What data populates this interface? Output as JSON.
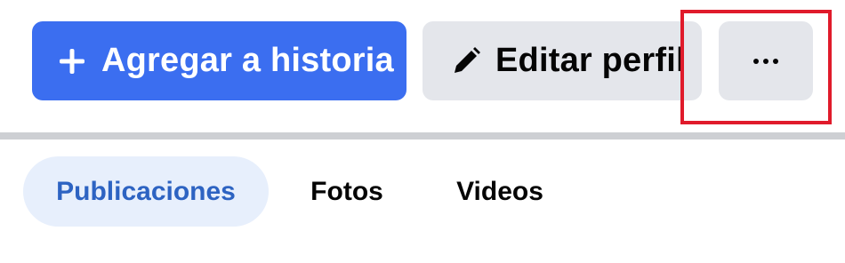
{
  "actions": {
    "add_story_label": "Agregar a historia",
    "edit_profile_label": "Editar perfil",
    "more_label": "···"
  },
  "tabs": [
    {
      "label": "Publicaciones",
      "active": true
    },
    {
      "label": "Fotos",
      "active": false
    },
    {
      "label": "Videos",
      "active": false
    }
  ],
  "colors": {
    "primary": "#3b6ef0",
    "secondary_bg": "#e4e6eb",
    "active_tab_bg": "#e7effc",
    "active_tab_text": "#2d63c2",
    "highlight": "#e01b2b"
  },
  "icons": {
    "add_story": "plus-icon",
    "edit_profile": "pencil-icon"
  }
}
